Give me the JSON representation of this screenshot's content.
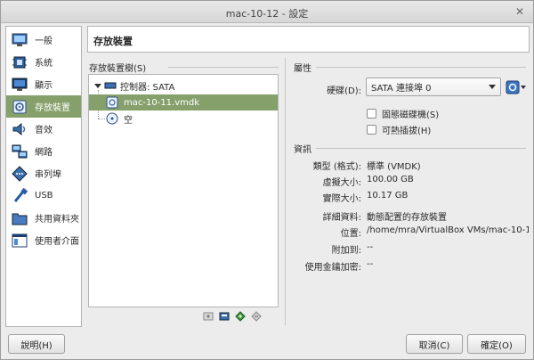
{
  "window": {
    "title": "mac-10-12 - 設定"
  },
  "sidebar": {
    "items": [
      {
        "label": "一般",
        "icon": "monitor-icon"
      },
      {
        "label": "系統",
        "icon": "chip-icon"
      },
      {
        "label": "顯示",
        "icon": "display-icon"
      },
      {
        "label": "存放裝置",
        "icon": "storage-icon"
      },
      {
        "label": "音效",
        "icon": "speaker-icon"
      },
      {
        "label": "網路",
        "icon": "network-icon"
      },
      {
        "label": "串列埠",
        "icon": "serial-port-icon"
      },
      {
        "label": "USB",
        "icon": "usb-icon"
      },
      {
        "label": "共用資料夾",
        "icon": "folder-icon"
      },
      {
        "label": "使用者介面",
        "icon": "ui-icon"
      }
    ],
    "active_index": 3
  },
  "header": {
    "title": "存放裝置"
  },
  "tree": {
    "title": "存放裝置樹(S)",
    "controller": "控制器: SATA",
    "items": [
      {
        "label": "mac-10-11.vmdk",
        "icon": "hard-disk-icon"
      },
      {
        "label": "空",
        "icon": "optical-disc-icon"
      }
    ]
  },
  "attributes": {
    "title": "屬性",
    "hard_disk_label": "硬碟(D):",
    "hard_disk_value": "SATA 連接埠 0",
    "solid_state_label": "固態磁碟機(S)",
    "hot_plug_label": "可熱插拔(H)"
  },
  "info": {
    "title": "資訊",
    "rows": [
      {
        "label": "類型 (格式):",
        "value": "標準 (VMDK)"
      },
      {
        "label": "虛擬大小:",
        "value": "100.00 GB"
      },
      {
        "label": "實際大小:",
        "value": "10.17 GB"
      },
      {
        "label": "詳細資料:",
        "value": "動態配置的存放裝置"
      },
      {
        "label": "位置:",
        "value": "/home/mra/VirtualBox VMs/mac-10-11/..."
      },
      {
        "label": "附加到:",
        "value": "--"
      },
      {
        "label": "使用金鑰加密:",
        "value": "--"
      }
    ]
  },
  "buttons": {
    "help": "說明(H)",
    "cancel": "取消(C)",
    "ok": "確定(O)"
  },
  "colors": {
    "accent": "#86a06b"
  }
}
